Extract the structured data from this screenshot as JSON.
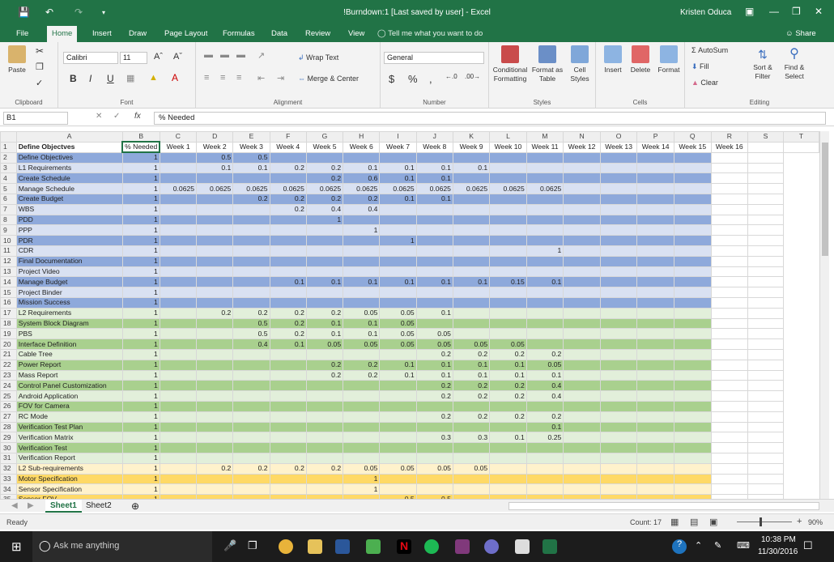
{
  "window": {
    "title": "!Burndown:1 [Last saved by user] - Excel",
    "user": "Kristen Oduca"
  },
  "tabs": [
    "File",
    "Home",
    "Insert",
    "Draw",
    "Page Layout",
    "Formulas",
    "Data",
    "Review",
    "View"
  ],
  "tell_me": "Tell me what you want to do",
  "share": "Share",
  "ribbon": {
    "paste": "Paste",
    "font_name": "Calibri",
    "font_size": "11",
    "bold": "B",
    "italic": "I",
    "underline": "U",
    "wrap_text": "Wrap Text",
    "merge_center": "Merge & Center",
    "number_format": "General",
    "conditional": "Conditional Formatting",
    "format_table": "Format as Table",
    "cell_styles": "Cell Styles",
    "insert": "Insert",
    "delete": "Delete",
    "format": "Format",
    "autosum": "AutoSum",
    "fill": "Fill",
    "clear": "Clear",
    "sort_filter": "Sort & Filter",
    "find_select": "Find & Select",
    "groups": [
      "Clipboard",
      "Font",
      "Alignment",
      "Number",
      "Styles",
      "Cells",
      "Editing"
    ]
  },
  "formula": {
    "cell": "B1",
    "fx": "fx",
    "value": "% Needed"
  },
  "columns": [
    "A",
    "B",
    "C",
    "D",
    "E",
    "F",
    "G",
    "H",
    "I",
    "J",
    "K",
    "L",
    "M",
    "N",
    "O",
    "P",
    "Q",
    "R",
    "S",
    "T"
  ],
  "header_row": [
    "Define Objectves",
    "% Needed",
    "Week 1",
    "Week 2",
    "Week 3",
    "Week 4",
    "Week 5",
    "Week 6",
    "Week 7",
    "Week 8",
    "Week 9",
    "Week 10",
    "Week 11",
    "Week 12",
    "Week 13",
    "Week 14",
    "Week 15",
    "Week 16"
  ],
  "row_colors": {
    "blue_dark": "#8ea9db",
    "blue_light": "#d9e1f2",
    "green_dark": "#a9d08e",
    "green_light": "#e2efda",
    "yellow_dark": "#ffd966",
    "yellow_light": "#fff2cc"
  },
  "rows": [
    {
      "n": 2,
      "name": "Define Objectives",
      "c": "blue_dark",
      "v": [
        "1",
        "",
        "0.5",
        "0.5",
        "",
        "",
        "",
        "",
        "",
        "",
        "",
        "",
        "",
        "",
        "",
        ""
      ]
    },
    {
      "n": 3,
      "name": "L1 Requirements",
      "c": "blue_light",
      "v": [
        "1",
        "",
        "0.1",
        "0.1",
        "0.2",
        "0.2",
        "0.1",
        "0.1",
        "0.1",
        "0.1",
        "",
        "",
        "",
        "",
        "",
        ""
      ]
    },
    {
      "n": 4,
      "name": "Create Schedule",
      "c": "blue_dark",
      "v": [
        "1",
        "",
        "",
        "",
        "",
        "0.2",
        "0.6",
        "0.1",
        "0.1",
        "",
        "",
        "",
        "",
        "",
        "",
        ""
      ]
    },
    {
      "n": 5,
      "name": "Manage Schedule",
      "c": "blue_light",
      "v": [
        "1",
        "0.0625",
        "0.0625",
        "0.0625",
        "0.0625",
        "0.0625",
        "0.0625",
        "0.0625",
        "0.0625",
        "0.0625",
        "0.0625",
        "0.0625",
        "",
        "",
        "",
        ""
      ]
    },
    {
      "n": 6,
      "name": "Create Budget",
      "c": "blue_dark",
      "v": [
        "1",
        "",
        "",
        "0.2",
        "0.2",
        "0.2",
        "0.2",
        "0.1",
        "0.1",
        "",
        "",
        "",
        "",
        "",
        "",
        ""
      ]
    },
    {
      "n": 7,
      "name": "WBS",
      "c": "blue_light",
      "v": [
        "1",
        "",
        "",
        "",
        "0.2",
        "0.4",
        "0.4",
        "",
        "",
        "",
        "",
        "",
        "",
        "",
        "",
        ""
      ]
    },
    {
      "n": 8,
      "name": "PDD",
      "c": "blue_dark",
      "v": [
        "1",
        "",
        "",
        "",
        "",
        "1",
        "",
        "",
        "",
        "",
        "",
        "",
        "",
        "",
        "",
        ""
      ]
    },
    {
      "n": 9,
      "name": "PPP",
      "c": "blue_light",
      "v": [
        "1",
        "",
        "",
        "",
        "",
        "",
        "1",
        "",
        "",
        "",
        "",
        "",
        "",
        "",
        "",
        ""
      ]
    },
    {
      "n": 10,
      "name": "PDR",
      "c": "blue_dark",
      "v": [
        "1",
        "",
        "",
        "",
        "",
        "",
        "",
        "1",
        "",
        "",
        "",
        "",
        "",
        "",
        "",
        ""
      ]
    },
    {
      "n": 11,
      "name": "CDR",
      "c": "blue_light",
      "v": [
        "1",
        "",
        "",
        "",
        "",
        "",
        "",
        "",
        "",
        "",
        "",
        "1",
        "",
        "",
        "",
        ""
      ]
    },
    {
      "n": 12,
      "name": "Final Documentation",
      "c": "blue_dark",
      "v": [
        "1",
        "",
        "",
        "",
        "",
        "",
        "",
        "",
        "",
        "",
        "",
        "",
        "",
        "",
        "",
        ""
      ]
    },
    {
      "n": 13,
      "name": "Project Video",
      "c": "blue_light",
      "v": [
        "1",
        "",
        "",
        "",
        "",
        "",
        "",
        "",
        "",
        "",
        "",
        "",
        "",
        "",
        "",
        ""
      ]
    },
    {
      "n": 14,
      "name": "Manage Budget",
      "c": "blue_dark",
      "v": [
        "1",
        "",
        "",
        "",
        "0.1",
        "0.1",
        "0.1",
        "0.1",
        "0.1",
        "0.1",
        "0.15",
        "0.1",
        "",
        "",
        "",
        ""
      ]
    },
    {
      "n": 15,
      "name": "Project Binder",
      "c": "blue_light",
      "v": [
        "1",
        "",
        "",
        "",
        "",
        "",
        "",
        "",
        "",
        "",
        "",
        "",
        "",
        "",
        "",
        ""
      ]
    },
    {
      "n": 16,
      "name": "Mission Success",
      "c": "blue_dark",
      "v": [
        "1",
        "",
        "",
        "",
        "",
        "",
        "",
        "",
        "",
        "",
        "",
        "",
        "",
        "",
        "",
        ""
      ]
    },
    {
      "n": 17,
      "name": "L2 Requirements",
      "c": "green_light",
      "v": [
        "1",
        "",
        "0.2",
        "0.2",
        "0.2",
        "0.2",
        "0.05",
        "0.05",
        "0.1",
        "",
        "",
        "",
        "",
        "",
        "",
        ""
      ]
    },
    {
      "n": 18,
      "name": "System Block Diagram",
      "c": "green_dark",
      "v": [
        "1",
        "",
        "",
        "0.5",
        "0.2",
        "0.1",
        "0.1",
        "0.05",
        "",
        "",
        "",
        "",
        "",
        "",
        "",
        ""
      ]
    },
    {
      "n": 19,
      "name": "PBS",
      "c": "green_light",
      "v": [
        "1",
        "",
        "",
        "0.5",
        "0.2",
        "0.1",
        "0.1",
        "0.05",
        "0.05",
        "",
        "",
        "",
        "",
        "",
        "",
        ""
      ]
    },
    {
      "n": 20,
      "name": "Interface Definition",
      "c": "green_dark",
      "v": [
        "1",
        "",
        "",
        "0.4",
        "0.1",
        "0.05",
        "0.05",
        "0.05",
        "0.05",
        "0.05",
        "0.05",
        "",
        "",
        "",
        "",
        ""
      ]
    },
    {
      "n": 21,
      "name": "Cable Tree",
      "c": "green_light",
      "v": [
        "1",
        "",
        "",
        "",
        "",
        "",
        "",
        "",
        "0.2",
        "0.2",
        "0.2",
        "0.2",
        "",
        "",
        "",
        ""
      ]
    },
    {
      "n": 22,
      "name": "Power Report",
      "c": "green_dark",
      "v": [
        "1",
        "",
        "",
        "",
        "",
        "0.2",
        "0.2",
        "0.1",
        "0.1",
        "0.1",
        "0.1",
        "0.05",
        "",
        "",
        "",
        ""
      ]
    },
    {
      "n": 23,
      "name": "Mass Report",
      "c": "green_light",
      "v": [
        "1",
        "",
        "",
        "",
        "",
        "0.2",
        "0.2",
        "0.1",
        "0.1",
        "0.1",
        "0.1",
        "0.1",
        "",
        "",
        "",
        ""
      ]
    },
    {
      "n": 24,
      "name": "Control Panel Customization",
      "c": "green_dark",
      "v": [
        "1",
        "",
        "",
        "",
        "",
        "",
        "",
        "",
        "0.2",
        "0.2",
        "0.2",
        "0.4",
        "",
        "",
        "",
        ""
      ]
    },
    {
      "n": 25,
      "name": "Android Application",
      "c": "green_light",
      "v": [
        "1",
        "",
        "",
        "",
        "",
        "",
        "",
        "",
        "0.2",
        "0.2",
        "0.2",
        "0.4",
        "",
        "",
        "",
        ""
      ]
    },
    {
      "n": 26,
      "name": "FOV for Camera",
      "c": "green_dark",
      "v": [
        "1",
        "",
        "",
        "",
        "",
        "",
        "",
        "",
        "",
        "",
        "",
        "",
        "",
        "",
        "",
        ""
      ]
    },
    {
      "n": 27,
      "name": "RC Mode",
      "c": "green_light",
      "v": [
        "1",
        "",
        "",
        "",
        "",
        "",
        "",
        "",
        "0.2",
        "0.2",
        "0.2",
        "0.2",
        "",
        "",
        "",
        ""
      ]
    },
    {
      "n": 28,
      "name": "Verification Test Plan",
      "c": "green_dark",
      "v": [
        "1",
        "",
        "",
        "",
        "",
        "",
        "",
        "",
        "",
        "",
        "",
        "0.1",
        "",
        "",
        "",
        ""
      ]
    },
    {
      "n": 29,
      "name": "Verification Matrix",
      "c": "green_light",
      "v": [
        "1",
        "",
        "",
        "",
        "",
        "",
        "",
        "",
        "0.3",
        "0.3",
        "0.1",
        "0.25",
        "",
        "",
        "",
        ""
      ]
    },
    {
      "n": 30,
      "name": "Verification Test",
      "c": "green_dark",
      "v": [
        "1",
        "",
        "",
        "",
        "",
        "",
        "",
        "",
        "",
        "",
        "",
        "",
        "",
        "",
        "",
        ""
      ]
    },
    {
      "n": 31,
      "name": "Verification Report",
      "c": "green_light",
      "v": [
        "1",
        "",
        "",
        "",
        "",
        "",
        "",
        "",
        "",
        "",
        "",
        "",
        "",
        "",
        "",
        ""
      ]
    },
    {
      "n": 32,
      "name": "L2 Sub-requirements",
      "c": "yellow_light",
      "v": [
        "1",
        "",
        "0.2",
        "0.2",
        "0.2",
        "0.2",
        "0.05",
        "0.05",
        "0.05",
        "0.05",
        "",
        "",
        "",
        "",
        "",
        ""
      ]
    },
    {
      "n": 33,
      "name": "Motor Specification",
      "c": "yellow_dark",
      "v": [
        "1",
        "",
        "",
        "",
        "",
        "",
        "1",
        "",
        "",
        "",
        "",
        "",
        "",
        "",
        "",
        ""
      ]
    },
    {
      "n": 34,
      "name": "Sensor Specification",
      "c": "yellow_light",
      "v": [
        "1",
        "",
        "",
        "",
        "",
        "",
        "1",
        "",
        "",
        "",
        "",
        "",
        "",
        "",
        "",
        ""
      ]
    },
    {
      "n": 35,
      "name": "Sensor FOV",
      "c": "yellow_dark",
      "v": [
        "1",
        "",
        "",
        "",
        "",
        "",
        "",
        "0.5",
        "0.5",
        "",
        "",
        "",
        "",
        "",
        "",
        ""
      ]
    }
  ],
  "sheets": [
    "Sheet1",
    "Sheet2"
  ],
  "status": {
    "ready": "Ready",
    "count": "Count: 17",
    "zoom": "90%"
  },
  "taskbar": {
    "search": "Ask me anything",
    "time": "10:38 PM",
    "date": "11/30/2016"
  }
}
